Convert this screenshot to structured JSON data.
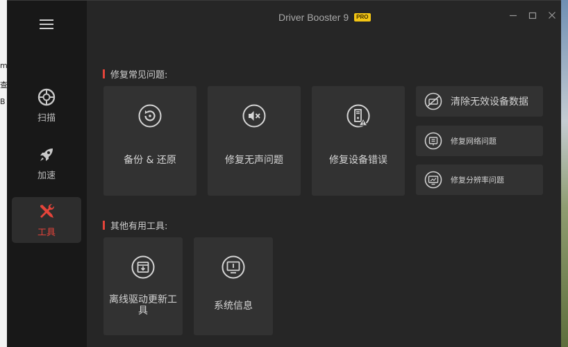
{
  "background_fragments": [
    "m",
    "查",
    "B"
  ],
  "app": {
    "title": "Driver Booster 9",
    "badge": "PRO"
  },
  "sidebar": {
    "items": [
      {
        "label": "扫描",
        "icon": "scan-icon",
        "active": false
      },
      {
        "label": "加速",
        "icon": "rocket-icon",
        "active": false
      },
      {
        "label": "工具",
        "icon": "tools-icon",
        "active": true
      }
    ]
  },
  "sections": {
    "common_fixes": {
      "title": "修复常见问题:",
      "cards": [
        {
          "label": "备份 & 还原",
          "icon": "backup-restore-icon"
        },
        {
          "label": "修复无声问题",
          "icon": "sound-mute-icon"
        },
        {
          "label": "修复设备错误",
          "icon": "device-error-icon"
        }
      ],
      "mini_cards": [
        {
          "label": "清除无效设备数据",
          "icon": "clean-device-icon"
        },
        {
          "label": "修复网络问题",
          "icon": "network-icon"
        },
        {
          "label": "修复分辨率问题",
          "icon": "resolution-icon"
        }
      ]
    },
    "other_tools": {
      "title": "其他有用工具:",
      "cards": [
        {
          "label": "离线驱动更新工具",
          "icon": "offline-update-icon"
        },
        {
          "label": "系统信息",
          "icon": "system-info-icon"
        }
      ]
    }
  },
  "colors": {
    "accent": "#e5443a",
    "panel": "#262626",
    "sidebar": "#181818",
    "card": "#323232",
    "badge": "#f3c514"
  }
}
